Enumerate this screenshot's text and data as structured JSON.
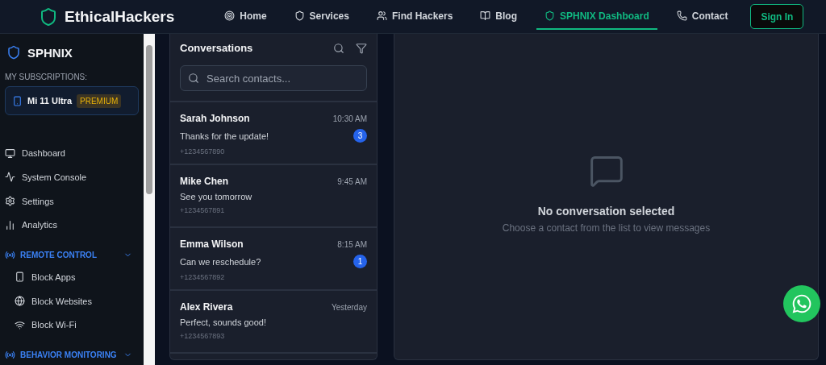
{
  "brand": {
    "name": "EthicalHackers"
  },
  "nav": [
    {
      "label": "Home",
      "selected": false
    },
    {
      "label": "Services",
      "selected": false
    },
    {
      "label": "Find Hackers",
      "selected": false
    },
    {
      "label": "Blog",
      "selected": false
    },
    {
      "label": "SPHNIX Dashboard",
      "selected": true
    },
    {
      "label": "Contact",
      "selected": false
    }
  ],
  "sign_in": "Sign In",
  "sidebar": {
    "title": "SPHNIX",
    "subscriptions_label": "MY SUBSCRIPTIONS:",
    "subscription": {
      "device": "Mi 11 Ultra",
      "plan": "PREMIUM"
    },
    "items": [
      {
        "kind": "link",
        "label": "Dashboard"
      },
      {
        "kind": "link",
        "label": "System Console"
      },
      {
        "kind": "link",
        "label": "Settings"
      },
      {
        "kind": "link",
        "label": "Analytics"
      },
      {
        "kind": "group",
        "label": "REMOTE CONTROL",
        "expanded": true,
        "children": [
          {
            "label": "Block Apps"
          },
          {
            "label": "Block Websites"
          },
          {
            "label": "Block Wi-Fi"
          }
        ]
      },
      {
        "kind": "group",
        "label": "BEHAVIOR MONITORING",
        "expanded": true
      }
    ]
  },
  "conversations": {
    "title": "Conversations",
    "search": {
      "placeholder": "Search contacts..."
    },
    "items": [
      {
        "name": "Sarah Johnson",
        "time": "10:30 AM",
        "message": "Thanks for the update!",
        "phone": "+1234567890",
        "unread": "3"
      },
      {
        "name": "Mike Chen",
        "time": "9:45 AM",
        "message": "See you tomorrow",
        "phone": "+1234567891"
      },
      {
        "name": "Emma Wilson",
        "time": "8:15 AM",
        "message": "Can we reschedule?",
        "phone": "+1234567892",
        "unread": "1"
      },
      {
        "name": "Alex Rivera",
        "time": "Yesterday",
        "message": "Perfect, sounds good!",
        "phone": "+1234567893"
      }
    ]
  },
  "empty_state": {
    "title": "No conversation selected",
    "hint": "Choose a contact from the list to view messages"
  }
}
